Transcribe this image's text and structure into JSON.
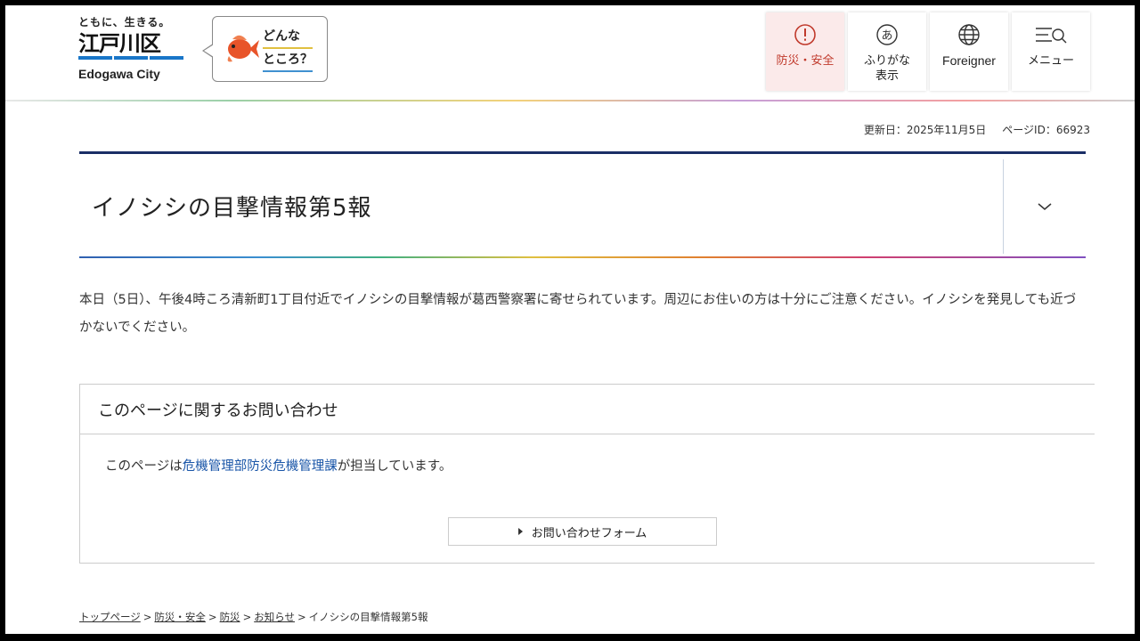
{
  "header": {
    "logo": {
      "tagline": "ともに、生きる。",
      "name": "江戸川区",
      "english": "Edogawa City"
    },
    "promo": {
      "line1": "どんな",
      "line2": "ところ？"
    },
    "nav": [
      {
        "label": "防災・安全",
        "icon": "alert-circle-icon"
      },
      {
        "label": "ふりがな",
        "sublabel": "表示",
        "icon": "hiragana-a-icon"
      },
      {
        "label": "Foreigner",
        "icon": "globe-icon"
      },
      {
        "label": "メニュー",
        "icon": "menu-search-icon"
      }
    ]
  },
  "meta": {
    "updated": "更新日：2025年11月5日",
    "page_id": "ページID：66923"
  },
  "article": {
    "title": "イノシシの目撃情報第5報",
    "body": "本日（5日）、午後4時ころ清新町1丁目付近でイノシシの目撃情報が葛西警察署に寄せられています。周辺にお住いの方は十分にご注意ください。イノシシを発見しても近づかないでください。"
  },
  "contact": {
    "heading": "このページに関するお問い合わせ",
    "prefix": "このページは",
    "dept_link": "危機管理部防災危機管理課",
    "suffix": "が担当しています。",
    "form_button": "お問い合わせフォーム"
  },
  "breadcrumb": {
    "items": [
      "トップページ",
      "防災・安全",
      "防災",
      "お知らせ"
    ],
    "current": "イノシシの目撃情報第5報",
    "separator": ">"
  },
  "colors": {
    "title_rule": "#1a2e66",
    "link": "#1a56a8",
    "alert_bg": "#fbeaea",
    "alert_fg": "#c0392b"
  }
}
